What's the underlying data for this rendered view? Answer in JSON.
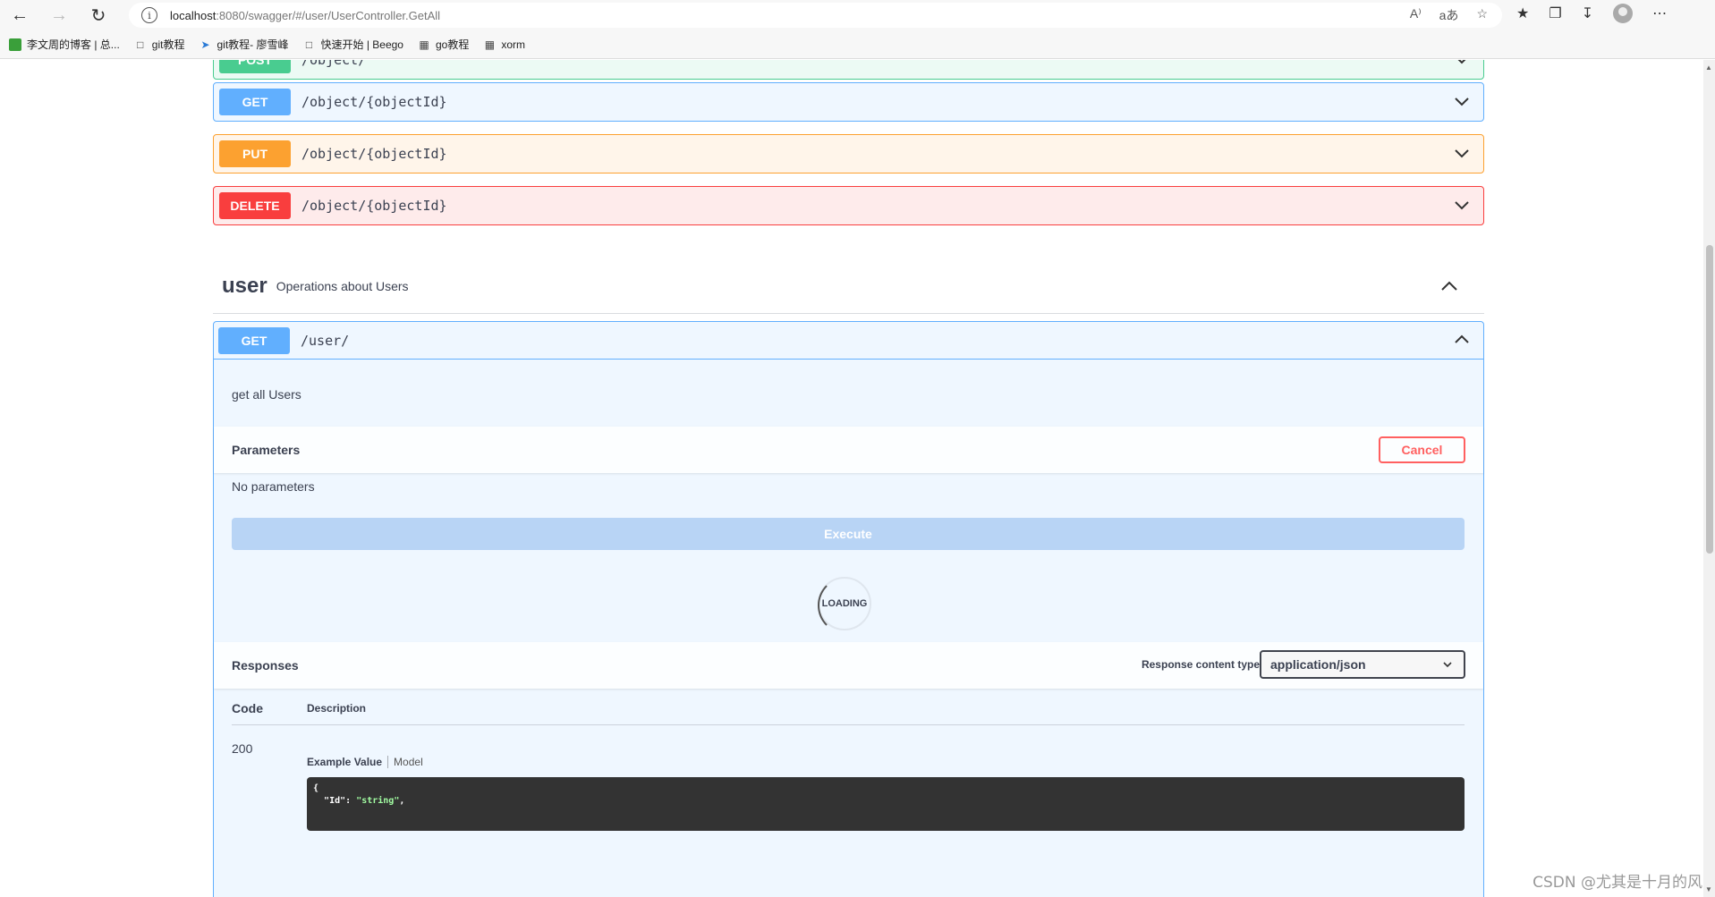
{
  "browser": {
    "url_host": "localhost",
    "url_rest": ":8080/swagger/#/user/UserController.GetAll",
    "bookmarks": [
      {
        "label": "李文周的博客 | 总..."
      },
      {
        "label": "git教程"
      },
      {
        "label": "git教程- 廖雪峰"
      },
      {
        "label": "快速开始 | Beego"
      },
      {
        "label": "go教程"
      },
      {
        "label": "xorm"
      }
    ],
    "read_aloud": "A⁾",
    "translate": "aあ"
  },
  "ops_above": [
    {
      "method": "POST",
      "path": "/object/"
    },
    {
      "method": "GET",
      "path": "/object/{objectId}"
    },
    {
      "method": "PUT",
      "path": "/object/{objectId}"
    },
    {
      "method": "DELETE",
      "path": "/object/{objectId}"
    }
  ],
  "tag": {
    "name": "user",
    "description": "Operations about Users"
  },
  "expanded_op": {
    "method": "GET",
    "path": "/user/",
    "description": "get all Users",
    "parameters_title": "Parameters",
    "cancel_label": "Cancel",
    "no_params": "No parameters",
    "execute_label": "Execute",
    "loading_label": "LOADING",
    "responses_title": "Responses",
    "response_content_type_label": "Response content type",
    "response_content_type": "application/json",
    "col_code": "Code",
    "col_description": "Description",
    "row_code": "200",
    "example_value_tab": "Example Value",
    "model_tab": "Model",
    "code_line1": "{",
    "code_key": "\"Id\"",
    "code_val": "\"string\""
  },
  "watermark": "CSDN @尤其是十月的风",
  "colors": {
    "post": "#49cc90",
    "get": "#61affe",
    "put": "#fca130",
    "delete": "#f93e3e"
  }
}
